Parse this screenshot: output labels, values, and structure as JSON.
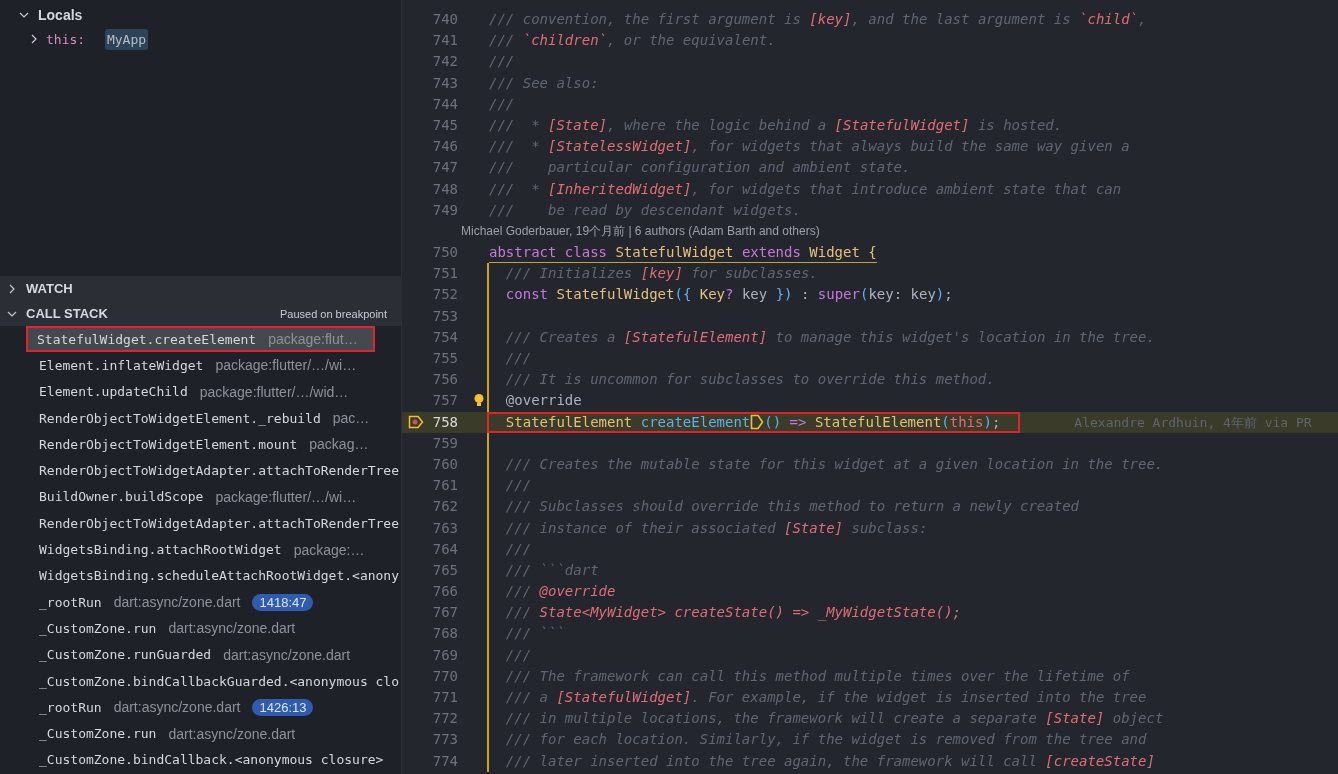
{
  "variables": {
    "title": "Locals",
    "expanded": true,
    "items": [
      {
        "name": "this:",
        "value": "MyApp",
        "expanded": false,
        "selected": true
      }
    ]
  },
  "watch": {
    "title": "WATCH",
    "expanded": false
  },
  "call_stack": {
    "title": "CALL STACK",
    "expanded": true,
    "status": "Paused on breakpoint",
    "frames": [
      {
        "name": "StatefulWidget.createElement",
        "source": "package:flut…",
        "selected": true,
        "boxed": true
      },
      {
        "name": "Element.inflateWidget",
        "source": "package:flutter/…/wi…",
        "selected": false,
        "boxed": false
      },
      {
        "name": "Element.updateChild",
        "source": "package:flutter/…/wid…",
        "selected": false,
        "boxed": false
      },
      {
        "name": "RenderObjectToWidgetElement._rebuild",
        "source": "pac…",
        "selected": false,
        "boxed": false
      },
      {
        "name": "RenderObjectToWidgetElement.mount",
        "source": "packag…",
        "selected": false,
        "boxed": false
      },
      {
        "name": "RenderObjectToWidgetAdapter.attachToRenderTree",
        "selected": false,
        "boxed": false
      },
      {
        "name": "BuildOwner.buildScope",
        "source": "package:flutter/…/wi…",
        "selected": false,
        "boxed": false
      },
      {
        "name": "RenderObjectToWidgetAdapter.attachToRenderTree",
        "selected": false,
        "boxed": false
      },
      {
        "name": "WidgetsBinding.attachRootWidget",
        "source": "package:…",
        "selected": false,
        "boxed": false
      },
      {
        "name": "WidgetsBinding.scheduleAttachRootWidget.<anony",
        "selected": false,
        "boxed": false
      },
      {
        "name": "_rootRun",
        "source": "dart:async/zone.dart",
        "badge": "1418:47",
        "selected": false,
        "boxed": false
      },
      {
        "name": "_CustomZone.run",
        "source": "dart:async/zone.dart",
        "selected": false,
        "boxed": false
      },
      {
        "name": "_CustomZone.runGuarded",
        "source": "dart:async/zone.dart",
        "selected": false,
        "boxed": false
      },
      {
        "name": "_CustomZone.bindCallbackGuarded.<anonymous clo",
        "selected": false,
        "boxed": false
      },
      {
        "name": "_rootRun",
        "source": "dart:async/zone.dart",
        "badge": "1426:13",
        "selected": false,
        "boxed": false
      },
      {
        "name": "_CustomZone.run",
        "source": "dart:async/zone.dart",
        "selected": false,
        "boxed": false
      },
      {
        "name": "_CustomZone.bindCallback.<anonymous closure>",
        "selected": false,
        "boxed": false
      }
    ]
  },
  "editor": {
    "lines": [
      {
        "kind": "code",
        "number": "740",
        "tokens": [
          {
            "kind": "comment",
            "text": "/// convention, the first argument is "
          },
          {
            "kind": "ref",
            "text": "[key]"
          },
          {
            "kind": "comment",
            "text": ", and the last argument is "
          },
          {
            "kind": "ref",
            "text": "`child`"
          },
          {
            "kind": "comment",
            "text": ","
          }
        ]
      },
      {
        "kind": "code",
        "number": "741",
        "tokens": [
          {
            "kind": "comment",
            "text": "/// "
          },
          {
            "kind": "ref",
            "text": "`children`"
          },
          {
            "kind": "comment",
            "text": ", or the equivalent."
          }
        ]
      },
      {
        "kind": "code",
        "number": "742",
        "tokens": [
          {
            "kind": "comment",
            "text": "///"
          }
        ]
      },
      {
        "kind": "code",
        "number": "743",
        "tokens": [
          {
            "kind": "comment",
            "text": "/// See also:"
          }
        ]
      },
      {
        "kind": "code",
        "number": "744",
        "tokens": [
          {
            "kind": "comment",
            "text": "///"
          }
        ]
      },
      {
        "kind": "code",
        "number": "745",
        "tokens": [
          {
            "kind": "comment",
            "text": "///  * "
          },
          {
            "kind": "ref",
            "text": "[State]"
          },
          {
            "kind": "comment",
            "text": ", where the logic behind a "
          },
          {
            "kind": "ref",
            "text": "[StatefulWidget]"
          },
          {
            "kind": "comment",
            "text": " is hosted."
          }
        ]
      },
      {
        "kind": "code",
        "number": "746",
        "tokens": [
          {
            "kind": "comment",
            "text": "///  * "
          },
          {
            "kind": "ref",
            "text": "[StatelessWidget]"
          },
          {
            "kind": "comment",
            "text": ", for widgets that always build the same way given a"
          }
        ]
      },
      {
        "kind": "code",
        "number": "747",
        "tokens": [
          {
            "kind": "comment",
            "text": "///    particular configuration and ambient state."
          }
        ]
      },
      {
        "kind": "code",
        "number": "748",
        "tokens": [
          {
            "kind": "comment",
            "text": "///  * "
          },
          {
            "kind": "ref",
            "text": "[InheritedWidget]"
          },
          {
            "kind": "comment",
            "text": ", for widgets that introduce ambient state that can"
          }
        ]
      },
      {
        "kind": "code",
        "number": "749",
        "tokens": [
          {
            "kind": "comment",
            "text": "///    be read by descendant widgets."
          }
        ]
      },
      {
        "kind": "blame",
        "text": "Michael Goderbauer, 19个月前 | 6 authors (Adam Barth and others)"
      },
      {
        "kind": "code",
        "number": "750",
        "scope_start": true,
        "tokens": [
          {
            "kind": "keyword",
            "text": "abstract class "
          },
          {
            "kind": "type",
            "text": "StatefulWidget"
          },
          {
            "kind": "keyword",
            "text": " extends "
          },
          {
            "kind": "type",
            "text": "Widget"
          },
          {
            "kind": "brace",
            "text": " {"
          }
        ]
      },
      {
        "kind": "code",
        "number": "751",
        "scope": true,
        "tokens": [
          {
            "kind": "comment",
            "text": "  /// Initializes "
          },
          {
            "kind": "ref",
            "text": "[key]"
          },
          {
            "kind": "comment",
            "text": " for subclasses."
          }
        ]
      },
      {
        "kind": "code",
        "number": "752",
        "scope": true,
        "tokens": [
          {
            "kind": "keyword",
            "text": "  const "
          },
          {
            "kind": "type",
            "text": "StatefulWidget"
          },
          {
            "kind": "paren",
            "text": "({ "
          },
          {
            "kind": "type",
            "text": "Key"
          },
          {
            "kind": "keyword",
            "text": "?"
          },
          {
            "kind": "plain",
            "text": " key "
          },
          {
            "kind": "paren",
            "text": "})"
          },
          {
            "kind": "plain",
            "text": " : "
          },
          {
            "kind": "keyword",
            "text": "super"
          },
          {
            "kind": "paren",
            "text": "("
          },
          {
            "kind": "plain",
            "text": "key: key"
          },
          {
            "kind": "paren",
            "text": ")"
          },
          {
            "kind": "plain",
            "text": ";"
          }
        ]
      },
      {
        "kind": "code",
        "number": "753",
        "scope": true
      },
      {
        "kind": "code",
        "number": "754",
        "scope": true,
        "tokens": [
          {
            "kind": "comment",
            "text": "  /// Creates a "
          },
          {
            "kind": "ref",
            "text": "[StatefulElement]"
          },
          {
            "kind": "comment",
            "text": " to manage this widget's location in the tree."
          }
        ]
      },
      {
        "kind": "code",
        "number": "755",
        "scope": true,
        "tokens": [
          {
            "kind": "comment",
            "text": "  ///"
          }
        ]
      },
      {
        "kind": "code",
        "number": "756",
        "scope": true,
        "tokens": [
          {
            "kind": "comment",
            "text": "  /// It is uncommon for subclasses to override this method."
          }
        ]
      },
      {
        "kind": "code",
        "number": "757",
        "scope": true,
        "lightbulb": true,
        "tokens": [
          {
            "kind": "plain",
            "text": "  @override"
          }
        ]
      },
      {
        "kind": "code",
        "number": "758",
        "scope": true,
        "current": true,
        "breakpoint": true,
        "boxed": true,
        "annotation": "Alexandre Ardhuin, 4年前 via PR",
        "tokens": [
          {
            "kind": "type",
            "text": "  StatefulElement "
          },
          {
            "kind": "func",
            "text": "createElement"
          },
          {
            "kind": "marker"
          },
          {
            "kind": "paren",
            "text": "()"
          },
          {
            "kind": "keyword",
            "text": " => "
          },
          {
            "kind": "type",
            "text": "StatefulElement"
          },
          {
            "kind": "paren",
            "text": "("
          },
          {
            "kind": "variable",
            "text": "this"
          },
          {
            "kind": "paren",
            "text": ")"
          },
          {
            "kind": "plain",
            "text": ";"
          }
        ]
      },
      {
        "kind": "code",
        "number": "759",
        "scope": true
      },
      {
        "kind": "code",
        "number": "760",
        "scope": true,
        "tokens": [
          {
            "kind": "comment",
            "text": "  /// Creates the mutable state for this widget at a given location in the tree."
          }
        ]
      },
      {
        "kind": "code",
        "number": "761",
        "scope": true,
        "tokens": [
          {
            "kind": "comment",
            "text": "  ///"
          }
        ]
      },
      {
        "kind": "code",
        "number": "762",
        "scope": true,
        "tokens": [
          {
            "kind": "comment",
            "text": "  /// Subclasses should override this method to return a newly created"
          }
        ]
      },
      {
        "kind": "code",
        "number": "763",
        "scope": true,
        "tokens": [
          {
            "kind": "comment",
            "text": "  /// instance of their associated "
          },
          {
            "kind": "ref",
            "text": "[State]"
          },
          {
            "kind": "comment",
            "text": " subclass:"
          }
        ]
      },
      {
        "kind": "code",
        "number": "764",
        "scope": true,
        "tokens": [
          {
            "kind": "comment",
            "text": "  ///"
          }
        ]
      },
      {
        "kind": "code",
        "number": "765",
        "scope": true,
        "tokens": [
          {
            "kind": "comment",
            "text": "  /// ```dart"
          }
        ]
      },
      {
        "kind": "code",
        "number": "766",
        "scope": true,
        "tokens": [
          {
            "kind": "comment",
            "text": "  /// "
          },
          {
            "kind": "ref",
            "text": "@override"
          }
        ]
      },
      {
        "kind": "code",
        "number": "767",
        "scope": true,
        "tokens": [
          {
            "kind": "comment",
            "text": "  /// "
          },
          {
            "kind": "ref",
            "text": "State<MyWidget> createState() => _MyWidgetState();"
          }
        ]
      },
      {
        "kind": "code",
        "number": "768",
        "scope": true,
        "tokens": [
          {
            "kind": "comment",
            "text": "  /// ```"
          }
        ]
      },
      {
        "kind": "code",
        "number": "769",
        "scope": true,
        "tokens": [
          {
            "kind": "comment",
            "text": "  ///"
          }
        ]
      },
      {
        "kind": "code",
        "number": "770",
        "scope": true,
        "tokens": [
          {
            "kind": "comment",
            "text": "  /// The framework can call this method multiple times over the lifetime of"
          }
        ]
      },
      {
        "kind": "code",
        "number": "771",
        "scope": true,
        "tokens": [
          {
            "kind": "comment",
            "text": "  /// a "
          },
          {
            "kind": "ref",
            "text": "[StatefulWidget]"
          },
          {
            "kind": "comment",
            "text": ". For example, if the widget is inserted into the tree"
          }
        ]
      },
      {
        "kind": "code",
        "number": "772",
        "scope": true,
        "tokens": [
          {
            "kind": "comment",
            "text": "  /// in multiple locations, the framework will create a separate "
          },
          {
            "kind": "ref",
            "text": "[State]"
          },
          {
            "kind": "comment",
            "text": " object"
          }
        ]
      },
      {
        "kind": "code",
        "number": "773",
        "scope": true,
        "tokens": [
          {
            "kind": "comment",
            "text": "  /// for each location. Similarly, if the widget is removed from the tree and"
          }
        ]
      },
      {
        "kind": "code",
        "number": "774",
        "scope": true,
        "tokens": [
          {
            "kind": "comment",
            "text": "  /// later inserted into the tree again, the framework will call "
          },
          {
            "kind": "ref",
            "text": "[createState]"
          }
        ]
      }
    ]
  }
}
